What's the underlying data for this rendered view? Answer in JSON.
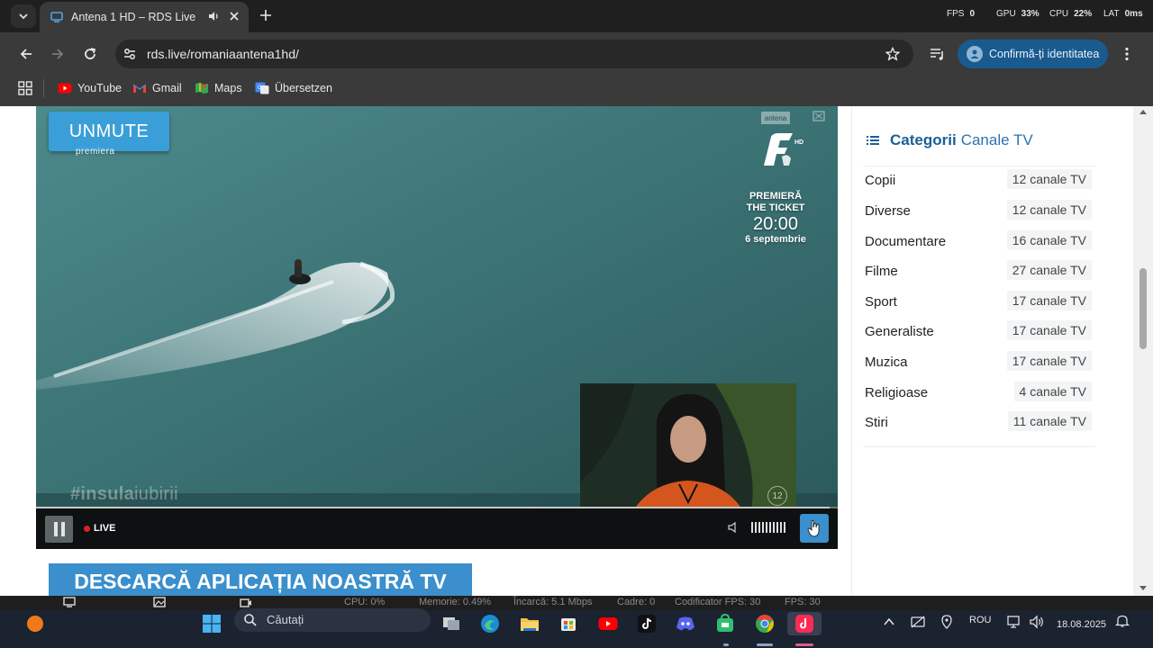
{
  "browser": {
    "tab": {
      "title": "Antena 1 HD – RDS Live"
    },
    "perf": {
      "fps_label": "FPS",
      "fps_value": "0",
      "gpu_label": "GPU",
      "gpu_value": "33%",
      "cpu_label": "CPU",
      "cpu_value": "22%",
      "lat_label": "LAT",
      "lat_value": "0ms"
    },
    "url": "rds.live/romaniaantena1hd/",
    "identity_label": "Confirmă-ți identitatea",
    "bookmarks": [
      {
        "label": "YouTube",
        "icon": "youtube-icon"
      },
      {
        "label": "Gmail",
        "icon": "gmail-icon"
      },
      {
        "label": "Maps",
        "icon": "maps-icon"
      },
      {
        "label": "Übersetzen",
        "icon": "translate-icon"
      }
    ]
  },
  "player": {
    "unmute_label": "UNMUTE",
    "premiera_tag": "premiera",
    "channel_top": "antena",
    "logo_hd": "HD",
    "promo": {
      "line1": "PREMIERĂ",
      "line2": "THE TICKET",
      "time": "20:00",
      "date": "6 septembrie"
    },
    "hashtag_bold": "#insula",
    "hashtag_light": "iubirii",
    "rating": "12",
    "live_label": "LIVE",
    "progress_pct": 99
  },
  "page": {
    "banner": "DESCARCĂ APLICAȚIA NOASTRĂ TV"
  },
  "sidebar": {
    "title_bold": "Categorii",
    "title_rest": "Canale TV",
    "categories": [
      {
        "name": "Copii",
        "count": "12 canale TV"
      },
      {
        "name": "Diverse",
        "count": "12 canale TV"
      },
      {
        "name": "Documentare",
        "count": "16 canale TV"
      },
      {
        "name": "Filme",
        "count": "27 canale TV"
      },
      {
        "name": "Sport",
        "count": "17 canale TV"
      },
      {
        "name": "Generaliste",
        "count": "17 canale TV"
      },
      {
        "name": "Muzica",
        "count": "17 canale TV"
      },
      {
        "name": "Religioase",
        "count": "4 canale TV"
      },
      {
        "name": "Stiri",
        "count": "11 canale TV"
      }
    ]
  },
  "stats": {
    "cpu": "CPU:  0%",
    "memory": "Memorie:  0.49%",
    "load": "Încarcă:  5.1 Mbps",
    "frames": "Cadre:  0",
    "encoder_fps": "Codificator FPS:  30",
    "fps": "FPS:  30"
  },
  "taskbar": {
    "search_placeholder": "Căutați",
    "language": "ROU",
    "date": "18.08.2025"
  },
  "colors": {
    "accent": "#3a8fcc",
    "sidebar_title": "#1a5e96",
    "live_dot": "#e02020"
  }
}
